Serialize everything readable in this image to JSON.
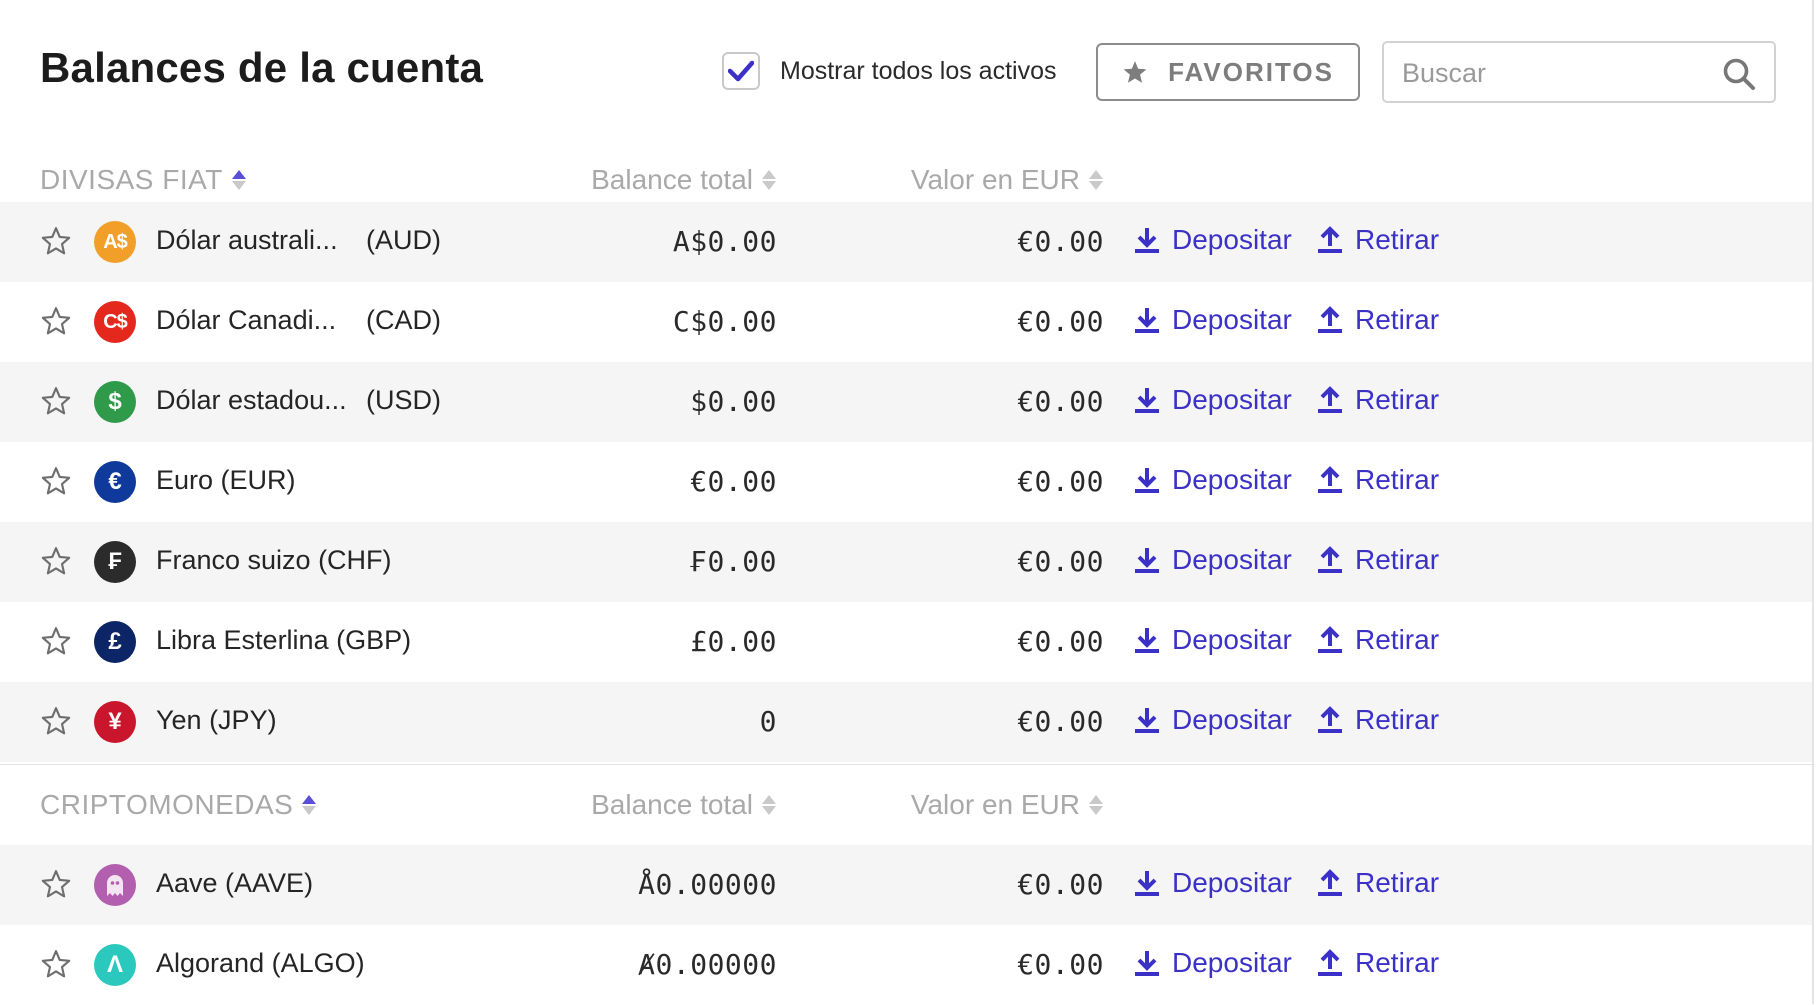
{
  "header": {
    "title": "Balances de la cuenta",
    "show_all_label": "Mostrar todos los activos",
    "show_all_checked": true,
    "favorites_label": "FAVORITOS",
    "search_placeholder": "Buscar"
  },
  "colors": {
    "accent": "#3b31c7",
    "text": "#252525",
    "muted": "#a9a9a9",
    "row_shade": "#f5f5f5"
  },
  "fiat": {
    "section_label": "DIVISAS FIAT",
    "col_balance": "Balance total",
    "col_value": "Valor en EUR",
    "rows": [
      {
        "name": "Dólar australi...",
        "code": "(AUD)",
        "balance": "A$0.00",
        "value": "€0.00",
        "icon": "aud-coin-icon",
        "glyph": "A$",
        "color": "#f29f2a"
      },
      {
        "name": "Dólar Canadi...",
        "code": "(CAD)",
        "balance": "C$0.00",
        "value": "€0.00",
        "icon": "cad-coin-icon",
        "glyph": "C$",
        "color": "#e5281e"
      },
      {
        "name": "Dólar estadou...",
        "code": "(USD)",
        "balance": "$0.00",
        "value": "€0.00",
        "icon": "usd-coin-icon",
        "glyph": "$",
        "color": "#2f9b4a"
      },
      {
        "name": "Euro (EUR)",
        "code": "",
        "balance": "€0.00",
        "value": "€0.00",
        "icon": "eur-coin-icon",
        "glyph": "€",
        "color": "#0f3a9b"
      },
      {
        "name": "Franco suizo (CHF)",
        "code": "",
        "balance": "₣0.00",
        "value": "€0.00",
        "icon": "chf-coin-icon",
        "glyph": "₣",
        "color": "#2b2b2b"
      },
      {
        "name": "Libra Esterlina (GBP)",
        "code": "",
        "balance": "£0.00",
        "value": "€0.00",
        "icon": "gbp-coin-icon",
        "glyph": "£",
        "color": "#0c2566"
      },
      {
        "name": "Yen (JPY)",
        "code": "",
        "balance": "0",
        "value": "€0.00",
        "icon": "jpy-coin-icon",
        "glyph": "¥",
        "color": "#c9162c"
      }
    ]
  },
  "crypto": {
    "section_label": "CRIPTOMONEDAS",
    "col_balance": "Balance total",
    "col_value": "Valor en EUR",
    "rows": [
      {
        "name": "Aave (AAVE)",
        "code": "",
        "balance": "Å0.00000",
        "value": "€0.00",
        "icon": "aave-ghost-icon",
        "glyph": "",
        "color": "#b35fb0"
      },
      {
        "name": "Algorand (ALGO)",
        "code": "",
        "balance": "Ⱥ0.00000",
        "value": "€0.00",
        "icon": "algorand-icon",
        "glyph": "Λ",
        "color": "#2bc9bd"
      }
    ]
  },
  "actions": {
    "deposit_label": "Depositar",
    "withdraw_label": "Retirar"
  }
}
